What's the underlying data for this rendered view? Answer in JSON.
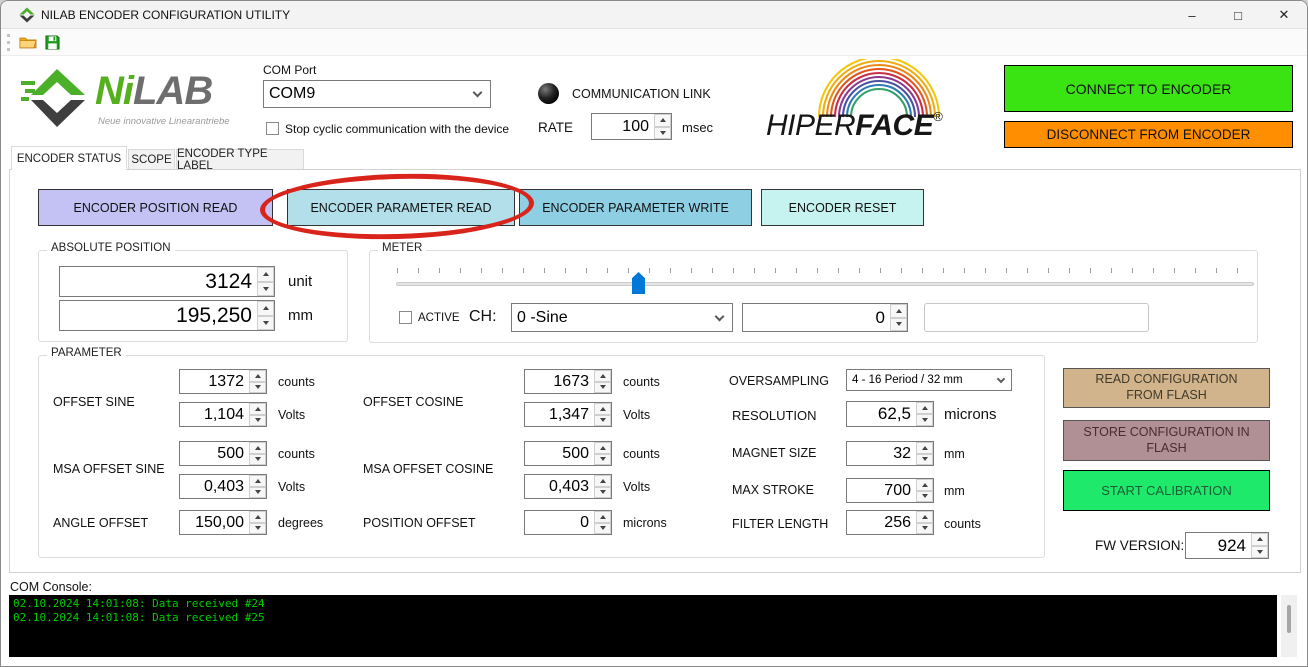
{
  "window": {
    "title": "NILAB ENCODER CONFIGURATION UTILITY",
    "minimize": "–",
    "maximize": "□",
    "close": "✕"
  },
  "logo": {
    "ni": "Ni",
    "lab": "LAB",
    "tagline": "Neue innovative Linearantriebe"
  },
  "header": {
    "com_port": {
      "label": "COM Port",
      "value": "COM9",
      "checkbox_label": "Stop cyclic communication with the device",
      "checked": false
    },
    "comm_link": {
      "label": "COMMUNICATION LINK",
      "rate_label": "RATE",
      "rate_value": "100",
      "rate_unit": "msec"
    },
    "connect_button": "CONNECT TO ENCODER",
    "disconnect_button": "DISCONNECT FROM ENCODER"
  },
  "hiperface": {
    "hiper": "HIPER",
    "face": "FACE",
    "reg": "®"
  },
  "tabs": [
    {
      "label": "ENCODER STATUS",
      "active": true
    },
    {
      "label": "SCOPE",
      "active": false
    },
    {
      "label": "ENCODER TYPE LABEL",
      "active": false
    }
  ],
  "actions": {
    "position_read": "ENCODER POSITION READ",
    "parameter_read": "ENCODER PARAMETER READ",
    "parameter_write": "ENCODER PARAMETER WRITE",
    "reset": "ENCODER RESET"
  },
  "absolute_position": {
    "title": "ABSOLUTE POSITION",
    "value_unit": "3124",
    "unit_unit": "unit",
    "value_mm": "195,250",
    "unit_mm": "mm"
  },
  "meter": {
    "title": "METER",
    "active_label": "ACTIVE",
    "ch_label": "CH:",
    "channel": "0 -Sine",
    "value": "0",
    "extra_field": ""
  },
  "parameter": {
    "title": "PARAMETER",
    "offset_sine": {
      "label": "OFFSET SINE",
      "counts": "1372",
      "counts_unit": "counts",
      "volts": "1,104",
      "volts_unit": "Volts"
    },
    "offset_cosine": {
      "label": "OFFSET COSINE",
      "counts": "1673",
      "counts_unit": "counts",
      "volts": "1,347",
      "volts_unit": "Volts"
    },
    "msa_offset_sine": {
      "label": "MSA OFFSET SINE",
      "counts": "500",
      "counts_unit": "counts",
      "volts": "0,403",
      "volts_unit": "Volts"
    },
    "msa_offset_cosine": {
      "label": "MSA OFFSET COSINE",
      "counts": "500",
      "counts_unit": "counts",
      "volts": "0,403",
      "volts_unit": "Volts"
    },
    "angle_offset": {
      "label": "ANGLE OFFSET",
      "value": "150,00",
      "unit": "degrees"
    },
    "position_offset": {
      "label": "POSITION OFFSET",
      "value": "0",
      "unit": "microns"
    },
    "oversampling": {
      "label": "OVERSAMPLING",
      "value": "4 - 16 Period / 32 mm"
    },
    "resolution": {
      "label": "RESOLUTION",
      "value": "62,5",
      "unit": "microns"
    },
    "magnet_size": {
      "label": "MAGNET SIZE",
      "value": "32",
      "unit": "mm"
    },
    "max_stroke": {
      "label": "MAX STROKE",
      "value": "700",
      "unit": "mm"
    },
    "filter_length": {
      "label": "FILTER LENGTH",
      "value": "256",
      "unit": "counts"
    }
  },
  "flash": {
    "read": "READ CONFIGURATION FROM FLASH",
    "store": "STORE CONFIGURATION IN FLASH",
    "calibrate": "START CALIBRATION"
  },
  "fw": {
    "label": "FW VERSION:",
    "value": "924"
  },
  "console": {
    "label": "COM Console:",
    "lines": [
      "02.10.2024 14:01:08: Data received #24",
      "02.10.2024 14:01:08: Data received #25"
    ]
  },
  "colors": {
    "connect_green": "#3ae312",
    "disconnect_orange": "#ff8e00",
    "btn_position_read": "#c4c1f4",
    "btn_parameter_read": "#b2dfe9",
    "btn_parameter_write": "#8ecfe4",
    "btn_encoder_reset": "#c6f3ef",
    "btn_read_flash": "#d2b48c",
    "btn_store_flash": "#b08f95",
    "btn_start_calibration": "#1fe96b",
    "annotation_red": "#d8241b",
    "console_green": "#00cc00",
    "slider_thumb_blue": "#0078d7",
    "led_off_black": "#000000"
  }
}
